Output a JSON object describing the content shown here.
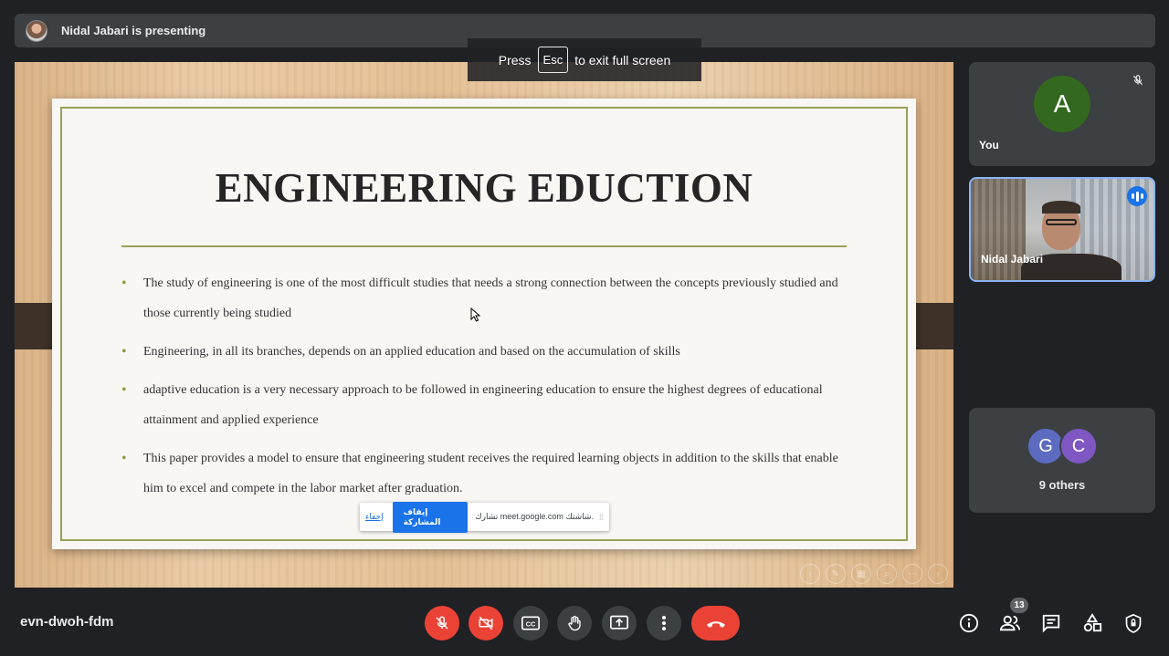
{
  "top_bar": {
    "presenting_text": "Nidal Jabari is presenting"
  },
  "fullscreen_banner": {
    "press": "Press",
    "key": "Esc",
    "suffix": "to exit full screen"
  },
  "slide": {
    "title": "ENGINEERING EDUCTION",
    "bullets": [
      "The study of engineering is one of the most difficult studies that needs a strong connection between the concepts previously studied and those currently being studied",
      "Engineering, in all its branches, depends on an applied education and based on the accumulation of skills",
      "adaptive education is a very necessary approach to be followed in engineering education to ensure the highest degrees of educational attainment and applied experience",
      "This paper provides a model to ensure that   engineering student receives the required learning objects in addition to the skills that enable him to excel and compete in the labor market after graduation."
    ]
  },
  "share_bar": {
    "hide_label": "إخفاء",
    "stop_label": "إيقاف المشاركة",
    "sharing_text": "تشارك meet.google.com شاشتك."
  },
  "participants": {
    "you": {
      "initial": "A",
      "name": "You",
      "avatar_color": "#33691e"
    },
    "presenter": {
      "name": "Nidal Jabari"
    },
    "others": {
      "initials": [
        "G",
        "C"
      ],
      "label": "9 others"
    }
  },
  "bottom_bar": {
    "meeting_code": "evn-dwoh-fdm",
    "people_count": "13"
  },
  "colors": {
    "end_call": "#ea4335",
    "accent": "#1a73e8",
    "speaking_border": "#8ab4f8"
  }
}
